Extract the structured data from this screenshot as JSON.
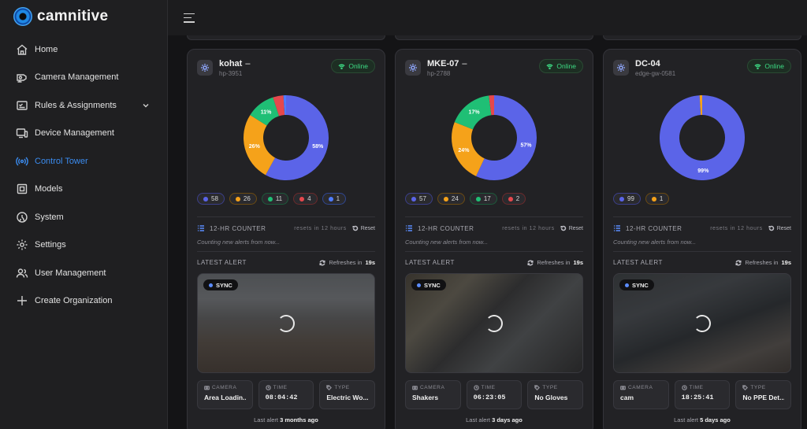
{
  "brand": {
    "name": "camnitive"
  },
  "sidebar": {
    "items": [
      {
        "label": "Home",
        "icon": "home-icon"
      },
      {
        "label": "Camera Management",
        "icon": "camera-icon"
      },
      {
        "label": "Rules & Assignments",
        "icon": "rules-icon",
        "expandable": true
      },
      {
        "label": "Device Management",
        "icon": "device-icon"
      },
      {
        "label": "Control Tower",
        "icon": "signal-icon",
        "active": true
      },
      {
        "label": "Models",
        "icon": "cube-icon"
      },
      {
        "label": "System",
        "icon": "system-icon"
      },
      {
        "label": "Settings",
        "icon": "gear-icon"
      },
      {
        "label": "User Management",
        "icon": "users-icon"
      },
      {
        "label": "Create Organization",
        "icon": "plus-icon"
      }
    ]
  },
  "colors": {
    "accent": "#3b8cf0",
    "blue": "#5b64e8",
    "orange": "#f5a21a",
    "green": "#1fbf75",
    "red": "#e5484d",
    "online": "#3ddc84"
  },
  "devices": [
    {
      "name": "kohat",
      "dash": "–",
      "id": "hp-3951",
      "status": "Online",
      "chart_data": {
        "type": "pie",
        "categories": [
          "blue",
          "orange",
          "green",
          "red",
          "lightblue"
        ],
        "values": [
          58,
          26,
          11,
          4,
          1
        ],
        "slice_labels": [
          "58%",
          "26%",
          "11%",
          "",
          ""
        ]
      },
      "chips": [
        "58",
        "26",
        "11",
        "4",
        "1"
      ],
      "counter": {
        "title": "12-HR COUNTER",
        "resets": "resets in 12 hours",
        "reset_label": "Reset",
        "note": "Counting new alerts from now..."
      },
      "latest": {
        "title": "LATEST ALERT",
        "refresh_prefix": "Refreshes in",
        "refresh_value": "19s",
        "sync": "SYNC"
      },
      "meta": {
        "camera_label": "CAMERA",
        "camera": "Area Loadin...",
        "time_label": "TIME",
        "time": "08:04:42",
        "type_label": "TYPE",
        "type": "Electric Wo..."
      },
      "last_prefix": "Last alert",
      "last_value": "3 months ago"
    },
    {
      "name": "MKE-07",
      "dash": "–",
      "id": "hp-2788",
      "status": "Online",
      "chart_data": {
        "type": "pie",
        "categories": [
          "blue",
          "orange",
          "green",
          "red"
        ],
        "values": [
          57,
          24,
          17,
          2
        ],
        "slice_labels": [
          "57%",
          "24%",
          "17%",
          ""
        ]
      },
      "chips": [
        "57",
        "24",
        "17",
        "2"
      ],
      "counter": {
        "title": "12-HR COUNTER",
        "resets": "resets in 12 hours",
        "reset_label": "Reset",
        "note": "Counting new alerts from now..."
      },
      "latest": {
        "title": "LATEST ALERT",
        "refresh_prefix": "Refreshes in",
        "refresh_value": "19s",
        "sync": "SYNC"
      },
      "meta": {
        "camera_label": "CAMERA",
        "camera": "Shakers",
        "time_label": "TIME",
        "time": "06:23:05",
        "type_label": "TYPE",
        "type": "No Gloves"
      },
      "last_prefix": "Last alert",
      "last_value": "3 days ago"
    },
    {
      "name": "DC-04",
      "dash": "",
      "id": "edge-gw-0581",
      "status": "Online",
      "chart_data": {
        "type": "pie",
        "categories": [
          "blue",
          "orange"
        ],
        "values": [
          99,
          1
        ],
        "slice_labels": [
          "99%",
          ""
        ]
      },
      "chips": [
        "99",
        "1"
      ],
      "counter": {
        "title": "12-HR COUNTER",
        "resets": "resets in 12 hours",
        "reset_label": "Reset",
        "note": "Counting new alerts from now..."
      },
      "latest": {
        "title": "LATEST ALERT",
        "refresh_prefix": "Refreshes in",
        "refresh_value": "19s",
        "sync": "SYNC"
      },
      "meta": {
        "camera_label": "CAMERA",
        "camera": "cam",
        "time_label": "TIME",
        "time": "18:25:41",
        "type_label": "TYPE",
        "type": "No PPE Det..."
      },
      "last_prefix": "Last alert",
      "last_value": "5 days ago"
    }
  ]
}
